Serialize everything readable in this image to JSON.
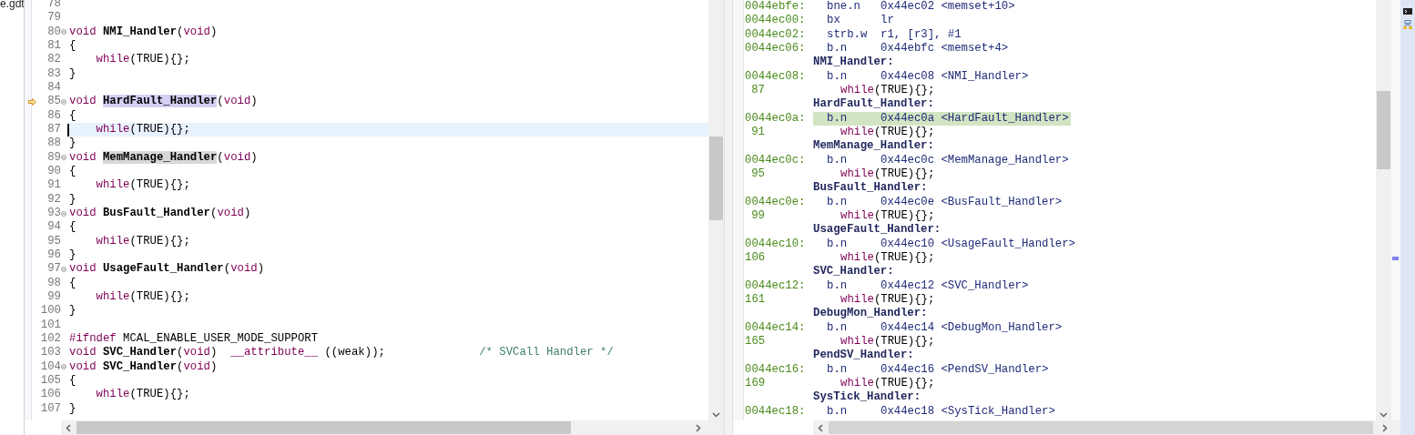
{
  "explorer_fragment": {
    "text": "e.gdt"
  },
  "editor": {
    "lines": [
      {
        "number": "78",
        "fold": false,
        "current": false,
        "instruction_pointer": false
      },
      {
        "number": "79",
        "fold": false,
        "current": false,
        "instruction_pointer": false
      },
      {
        "number": "80",
        "fold": true,
        "current": false,
        "instruction_pointer": false,
        "tokens": [
          {
            "kind": "keyword",
            "s": "void "
          },
          {
            "kind": "function",
            "s": "NMI_Handler"
          },
          {
            "kind": "plain",
            "s": "("
          },
          {
            "kind": "keyword",
            "s": "void"
          },
          {
            "kind": "plain",
            "s": ")"
          }
        ]
      },
      {
        "number": "81",
        "fold": false,
        "current": false,
        "instruction_pointer": false,
        "tokens": [
          {
            "kind": "plain",
            "s": "{"
          }
        ]
      },
      {
        "number": "82",
        "fold": false,
        "current": false,
        "instruction_pointer": false,
        "tokens": [
          {
            "kind": "keyword",
            "s": "    while"
          },
          {
            "kind": "plain",
            "s": "(TRUE){};"
          }
        ]
      },
      {
        "number": "83",
        "fold": false,
        "current": false,
        "instruction_pointer": false,
        "tokens": [
          {
            "kind": "plain",
            "s": "}"
          }
        ]
      },
      {
        "number": "84",
        "fold": false,
        "current": false,
        "instruction_pointer": false
      },
      {
        "number": "85",
        "fold": true,
        "current": false,
        "instruction_pointer": true,
        "tokens": [
          {
            "kind": "keyword",
            "s": "void "
          },
          {
            "kind": "function",
            "s": "HardFault_Handler",
            "color": "#d4d0f4"
          },
          {
            "kind": "plain",
            "s": "("
          },
          {
            "kind": "keyword",
            "s": "void"
          },
          {
            "kind": "plain",
            "s": ")"
          }
        ]
      },
      {
        "number": "86",
        "fold": false,
        "current": false,
        "instruction_pointer": false,
        "tokens": [
          {
            "kind": "plain",
            "s": "{"
          }
        ]
      },
      {
        "number": "87",
        "fold": false,
        "current": true,
        "instruction_pointer": false,
        "tokens": [
          {
            "kind": "keyword",
            "s": "    while"
          },
          {
            "kind": "plain",
            "s": "(TRUE){};"
          }
        ]
      },
      {
        "number": "88",
        "fold": false,
        "current": false,
        "instruction_pointer": false,
        "tokens": [
          {
            "kind": "plain",
            "s": "}"
          }
        ]
      },
      {
        "number": "89",
        "fold": true,
        "current": false,
        "instruction_pointer": false,
        "tokens": [
          {
            "kind": "keyword",
            "s": "void "
          },
          {
            "kind": "function",
            "s": "MemManage_Handler",
            "color": "#d8d8d8"
          },
          {
            "kind": "plain",
            "s": "("
          },
          {
            "kind": "keyword",
            "s": "void"
          },
          {
            "kind": "plain",
            "s": ")"
          }
        ]
      },
      {
        "number": "90",
        "fold": false,
        "current": false,
        "instruction_pointer": false,
        "tokens": [
          {
            "kind": "plain",
            "s": "{"
          }
        ]
      },
      {
        "number": "91",
        "fold": false,
        "current": false,
        "instruction_pointer": false,
        "tokens": [
          {
            "kind": "keyword",
            "s": "    while"
          },
          {
            "kind": "plain",
            "s": "(TRUE){};"
          }
        ]
      },
      {
        "number": "92",
        "fold": false,
        "current": false,
        "instruction_pointer": false,
        "tokens": [
          {
            "kind": "plain",
            "s": "}"
          }
        ]
      },
      {
        "number": "93",
        "fold": true,
        "current": false,
        "instruction_pointer": false,
        "tokens": [
          {
            "kind": "keyword",
            "s": "void "
          },
          {
            "kind": "function",
            "s": "BusFault_Handler"
          },
          {
            "kind": "plain",
            "s": "("
          },
          {
            "kind": "keyword",
            "s": "void"
          },
          {
            "kind": "plain",
            "s": ")"
          }
        ]
      },
      {
        "number": "94",
        "fold": false,
        "current": false,
        "instruction_pointer": false,
        "tokens": [
          {
            "kind": "plain",
            "s": "{"
          }
        ]
      },
      {
        "number": "95",
        "fold": false,
        "current": false,
        "instruction_pointer": false,
        "tokens": [
          {
            "kind": "keyword",
            "s": "    while"
          },
          {
            "kind": "plain",
            "s": "(TRUE){};"
          }
        ]
      },
      {
        "number": "96",
        "fold": false,
        "current": false,
        "instruction_pointer": false,
        "tokens": [
          {
            "kind": "plain",
            "s": "}"
          }
        ]
      },
      {
        "number": "97",
        "fold": true,
        "current": false,
        "instruction_pointer": false,
        "tokens": [
          {
            "kind": "keyword",
            "s": "void "
          },
          {
            "kind": "function",
            "s": "UsageFault_Handler"
          },
          {
            "kind": "plain",
            "s": "("
          },
          {
            "kind": "keyword",
            "s": "void"
          },
          {
            "kind": "plain",
            "s": ")"
          }
        ]
      },
      {
        "number": "98",
        "fold": false,
        "current": false,
        "instruction_pointer": false,
        "tokens": [
          {
            "kind": "plain",
            "s": "{"
          }
        ]
      },
      {
        "number": "99",
        "fold": false,
        "current": false,
        "instruction_pointer": false,
        "tokens": [
          {
            "kind": "keyword",
            "s": "    while"
          },
          {
            "kind": "plain",
            "s": "(TRUE){};"
          }
        ]
      },
      {
        "number": "100",
        "fold": false,
        "current": false,
        "instruction_pointer": false,
        "tokens": [
          {
            "kind": "plain",
            "s": "}"
          }
        ]
      },
      {
        "number": "101",
        "fold": false,
        "current": false,
        "instruction_pointer": false
      },
      {
        "number": "102",
        "fold": false,
        "current": false,
        "instruction_pointer": false,
        "tokens": [
          {
            "kind": "keyword",
            "s": "#ifndef"
          },
          {
            "kind": "plain",
            "s": " MCAL_ENABLE_USER_MODE_SUPPORT"
          }
        ]
      },
      {
        "number": "103",
        "fold": false,
        "current": false,
        "instruction_pointer": false,
        "tokens": [
          {
            "kind": "keyword",
            "s": "void "
          },
          {
            "kind": "function",
            "s": "SVC_Handler"
          },
          {
            "kind": "plain",
            "s": "("
          },
          {
            "kind": "keyword",
            "s": "void"
          },
          {
            "kind": "plain",
            "s": ")  "
          },
          {
            "kind": "keyword",
            "s": "__attribute__"
          },
          {
            "kind": "plain",
            "s": " ((weak));              "
          },
          {
            "kind": "comment",
            "s": "/* SVCall Handler */"
          }
        ]
      },
      {
        "number": "104",
        "fold": true,
        "current": false,
        "instruction_pointer": false,
        "tokens": [
          {
            "kind": "keyword",
            "s": "void "
          },
          {
            "kind": "function",
            "s": "SVC_Handler"
          },
          {
            "kind": "plain",
            "s": "("
          },
          {
            "kind": "keyword",
            "s": "void"
          },
          {
            "kind": "plain",
            "s": ")"
          }
        ]
      },
      {
        "number": "105",
        "fold": false,
        "current": false,
        "instruction_pointer": false,
        "tokens": [
          {
            "kind": "plain",
            "s": "{"
          }
        ]
      },
      {
        "number": "106",
        "fold": false,
        "current": false,
        "instruction_pointer": false,
        "tokens": [
          {
            "kind": "keyword",
            "s": "    while"
          },
          {
            "kind": "plain",
            "s": "(TRUE){};"
          }
        ]
      },
      {
        "number": "107",
        "fold": false,
        "current": false,
        "instruction_pointer": false,
        "tokens": [
          {
            "kind": "plain",
            "s": "}"
          }
        ]
      }
    ]
  },
  "disassembly": {
    "rows": [
      {
        "kind": "instruction",
        "address": "0044ebfe:",
        "mnemonic": "bne.n",
        "operand": "0x44ec02 <memset+10>",
        "selected": false
      },
      {
        "kind": "instruction",
        "address": "0044ec00:",
        "mnemonic": "bx",
        "operand": "lr",
        "selected": false
      },
      {
        "kind": "instruction",
        "address": "0044ec02:",
        "mnemonic": "strb.w",
        "operand": "r1, [r3], #1",
        "selected": false
      },
      {
        "kind": "instruction",
        "address": "0044ec06:",
        "mnemonic": "b.n",
        "operand": "0x44ebfc <memset+4>",
        "selected": false
      },
      {
        "kind": "label",
        "text": "NMI_Handler:"
      },
      {
        "kind": "instruction",
        "address": "0044ec08:",
        "mnemonic": "b.n",
        "operand": "0x44ec08 <NMI_Handler>",
        "selected": false
      },
      {
        "kind": "source",
        "number": "87",
        "tokens": [
          {
            "kind": "keyword",
            "s": "while"
          },
          {
            "kind": "plain",
            "s": "(TRUE){};"
          }
        ]
      },
      {
        "kind": "label",
        "text": "HardFault_Handler:"
      },
      {
        "kind": "instruction",
        "address": "0044ec0a:",
        "mnemonic": "b.n",
        "operand": "0x44ec0a <HardFault_Handler>",
        "selected": true
      },
      {
        "kind": "source",
        "number": "91",
        "tokens": [
          {
            "kind": "keyword",
            "s": "while"
          },
          {
            "kind": "plain",
            "s": "(TRUE){};"
          }
        ]
      },
      {
        "kind": "label",
        "text": "MemManage_Handler:"
      },
      {
        "kind": "instruction",
        "address": "0044ec0c:",
        "mnemonic": "b.n",
        "operand": "0x44ec0c <MemManage_Handler>",
        "selected": false
      },
      {
        "kind": "source",
        "number": "95",
        "tokens": [
          {
            "kind": "keyword",
            "s": "while"
          },
          {
            "kind": "plain",
            "s": "(TRUE){};"
          }
        ]
      },
      {
        "kind": "label",
        "text": "BusFault_Handler:"
      },
      {
        "kind": "instruction",
        "address": "0044ec0e:",
        "mnemonic": "b.n",
        "operand": "0x44ec0e <BusFault_Handler>",
        "selected": false
      },
      {
        "kind": "source",
        "number": "99",
        "tokens": [
          {
            "kind": "keyword",
            "s": "while"
          },
          {
            "kind": "plain",
            "s": "(TRUE){};"
          }
        ]
      },
      {
        "kind": "label",
        "text": "UsageFault_Handler:"
      },
      {
        "kind": "instruction",
        "address": "0044ec10:",
        "mnemonic": "b.n",
        "operand": "0x44ec10 <UsageFault_Handler>",
        "selected": false
      },
      {
        "kind": "source",
        "number": "106",
        "tokens": [
          {
            "kind": "keyword",
            "s": "while"
          },
          {
            "kind": "plain",
            "s": "(TRUE){};"
          }
        ]
      },
      {
        "kind": "label",
        "text": "SVC_Handler:"
      },
      {
        "kind": "instruction",
        "address": "0044ec12:",
        "mnemonic": "b.n",
        "operand": "0x44ec12 <SVC_Handler>",
        "selected": false
      },
      {
        "kind": "source",
        "number": "161",
        "tokens": [
          {
            "kind": "keyword",
            "s": "while"
          },
          {
            "kind": "plain",
            "s": "(TRUE){};"
          }
        ]
      },
      {
        "kind": "label",
        "text": "DebugMon_Handler:"
      },
      {
        "kind": "instruction",
        "address": "0044ec14:",
        "mnemonic": "b.n",
        "operand": "0x44ec14 <DebugMon_Handler>",
        "selected": false
      },
      {
        "kind": "source",
        "number": "165",
        "tokens": [
          {
            "kind": "keyword",
            "s": "while"
          },
          {
            "kind": "plain",
            "s": "(TRUE){};"
          }
        ]
      },
      {
        "kind": "label",
        "text": "PendSV_Handler:"
      },
      {
        "kind": "instruction",
        "address": "0044ec16:",
        "mnemonic": "b.n",
        "operand": "0x44ec16 <PendSV_Handler>",
        "selected": false
      },
      {
        "kind": "source",
        "number": "169",
        "tokens": [
          {
            "kind": "keyword",
            "s": "while"
          },
          {
            "kind": "plain",
            "s": "(TRUE){};"
          }
        ]
      },
      {
        "kind": "label",
        "text": "SysTick_Handler:"
      },
      {
        "kind": "instruction",
        "address": "0044ec18:",
        "mnemonic": "b.n",
        "operand": "0x44ec18 <SysTick_Handler>",
        "selected": false
      }
    ]
  }
}
